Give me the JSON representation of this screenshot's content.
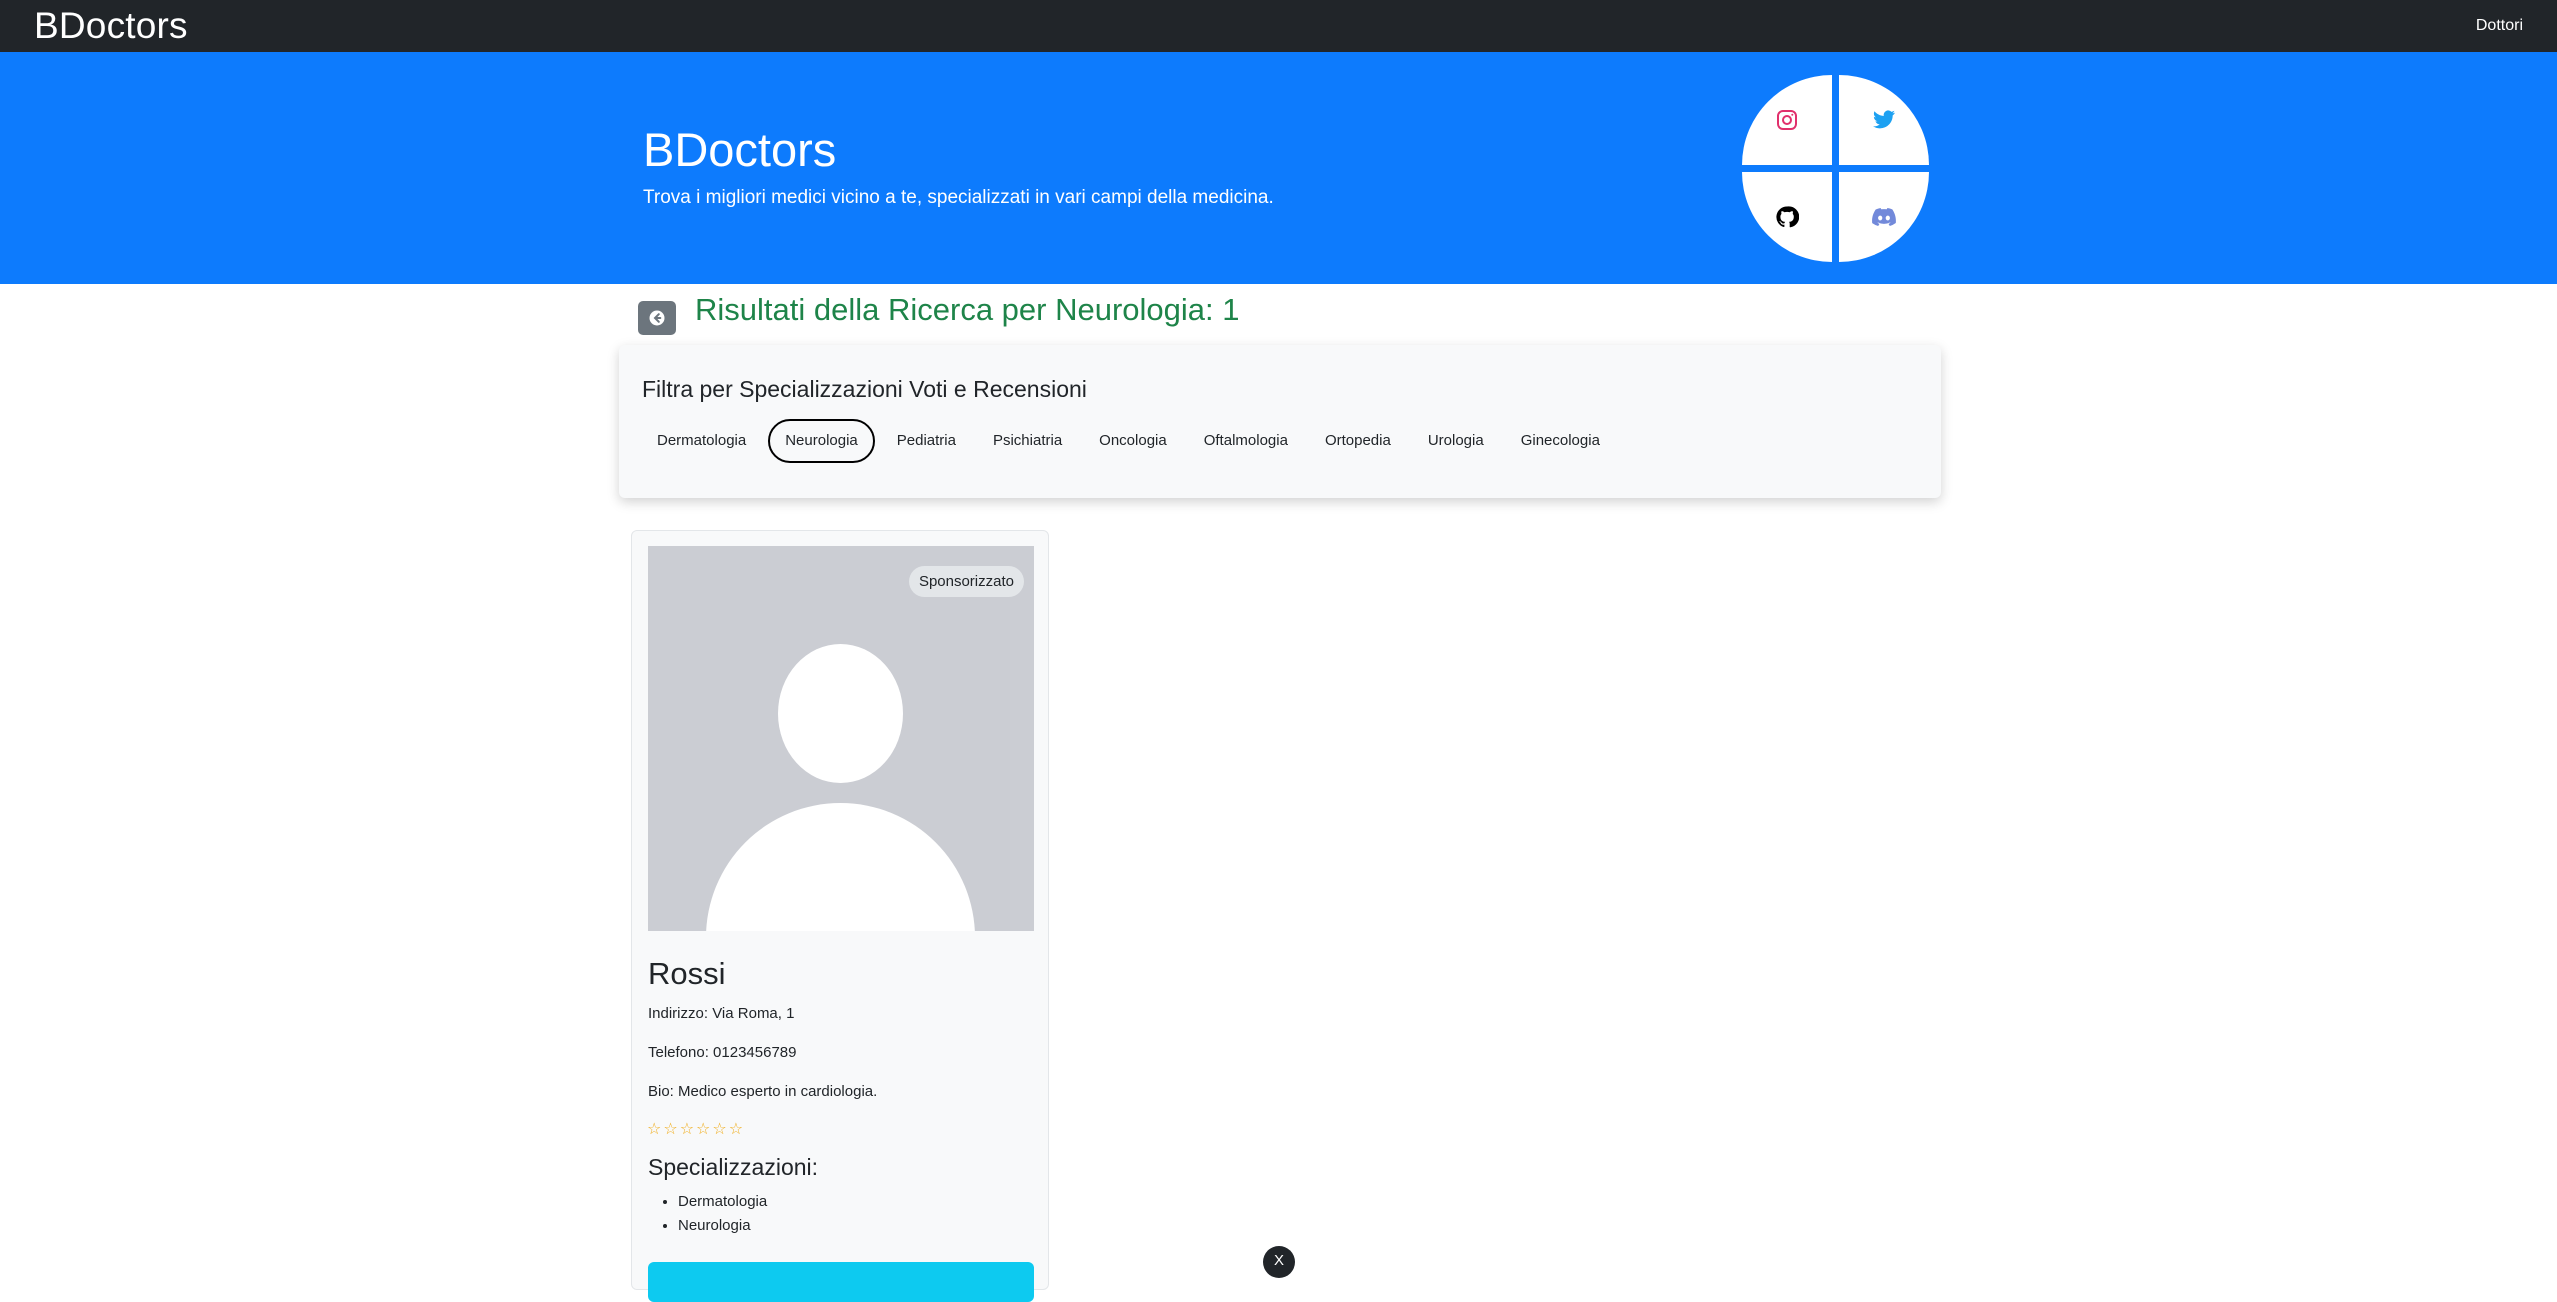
{
  "navbar": {
    "brand": "BDoctors",
    "link": "Dottori"
  },
  "hero": {
    "title": "BDoctors",
    "subtitle": "Trova i migliori medici vicino a te, specializzati in vari campi della medicina.",
    "social": [
      {
        "icon": "instagram-icon",
        "color": "#e1306c"
      },
      {
        "icon": "twitter-icon",
        "color": "#1da1f2"
      },
      {
        "icon": "github-icon",
        "color": "#000000"
      },
      {
        "icon": "discord-icon",
        "color": "#7289da"
      }
    ]
  },
  "results": {
    "title": "Risultati della Ricerca per Neurologia: 1"
  },
  "filter": {
    "title": "Filtra per Specializzazioni Voti e Recensioni",
    "specializations": [
      "Dermatologia",
      "Neurologia",
      "Pediatria",
      "Psichiatria",
      "Oncologia",
      "Oftalmologia",
      "Ortopedia",
      "Urologia",
      "Ginecologia"
    ],
    "active": "Neurologia"
  },
  "doctor": {
    "badge": "Sponsorizzato",
    "name": "Rossi",
    "address": "Indirizzo: Via Roma, 1",
    "phone": "Telefono: 0123456789",
    "bio": "Bio: Medico esperto in cardiologia.",
    "rating": 0,
    "rating_max": 6,
    "specializations_title": "Specializzazioni:",
    "specializations": [
      "Dermatologia",
      "Neurologia"
    ]
  },
  "overlay": {
    "close_label": "X"
  },
  "colors": {
    "navbar": "#212529",
    "hero": "#0d7bfd",
    "results_title": "#1e8449",
    "star": "#f0ad1c",
    "card_button": "#0dcaf0"
  }
}
